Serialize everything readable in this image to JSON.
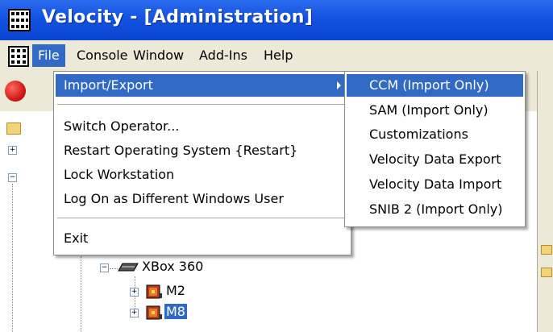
{
  "window": {
    "title": "Velocity - [Administration]"
  },
  "menubar": {
    "items": [
      "File",
      "Console",
      "Window",
      "Add-Ins",
      "Help"
    ]
  },
  "file_menu": {
    "import_export": "Import/Export",
    "switch_operator": "Switch Operator...",
    "restart_os": "Restart Operating System {Restart}",
    "lock_workstation": "Lock Workstation",
    "log_on_different": "Log On as Different Windows User",
    "exit": "Exit"
  },
  "import_export_submenu": {
    "items": [
      "CCM (Import Only)",
      "SAM (Import Only)",
      "Customizations",
      "Velocity Data Export",
      "Velocity Data Import",
      "SNIB 2 (Import Only)"
    ]
  },
  "tree": {
    "xbox_label": "XBox 360",
    "m2_label": "M2",
    "m8_label": "M8"
  },
  "colors": {
    "title_bar": "#0a45d1",
    "selection": "#316ac5",
    "menu_bg": "#ece9d8"
  },
  "icons": {
    "app": "grid-app-icon",
    "toolbar_red": "red-circle-icon",
    "submenu_arrow": "triangle-right-icon"
  }
}
